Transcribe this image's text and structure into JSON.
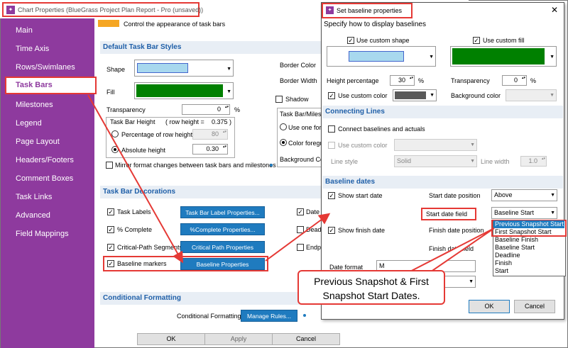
{
  "main_window": {
    "title": "Chart Properties (BlueGrass Project Plan Report - Pro (unsaved))",
    "header_text": "Control the appearance of task bars",
    "ok": "OK",
    "apply": "Apply",
    "cancel": "Cancel"
  },
  "sidebar": {
    "items": [
      {
        "label": "Main"
      },
      {
        "label": "Time Axis"
      },
      {
        "label": "Rows/Swimlanes"
      },
      {
        "label": "Task Bars"
      },
      {
        "label": "Milestones"
      },
      {
        "label": "Legend"
      },
      {
        "label": "Page Layout"
      },
      {
        "label": "Headers/Footers"
      },
      {
        "label": "Comment Boxes"
      },
      {
        "label": "Task Links"
      },
      {
        "label": "Advanced"
      },
      {
        "label": "Field Mappings"
      }
    ]
  },
  "styles": {
    "heading": "Default Task Bar Styles",
    "shape_label": "Shape",
    "fill_label": "Fill",
    "transparency_label": "Transparency",
    "transparency_value": "0",
    "pct": "%",
    "border_color": "Border Color",
    "border_width": "Border Width",
    "shadow": "Shadow",
    "height_group": "Task Bar Height",
    "row_height": "( row height =",
    "row_height_value": "0.375 )",
    "pct_row_height": "Percentage of row height",
    "pct_row_value": "80",
    "absolute_height": "Absolute height",
    "absolute_value": "0.30",
    "milestone_group": "Task Bar/Milestone",
    "use_one": "Use one fore",
    "color_fore": "Color foregro",
    "bg_color": "Background Colo",
    "mirror": "Mirror format changes between task bars and milestones"
  },
  "decorations": {
    "heading": "Task Bar Decorations",
    "task_labels": "Task Labels",
    "task_labels_btn": "Task Bar Label Properties...",
    "pct_complete": "% Complete",
    "pct_complete_btn": "%Complete Properties...",
    "critical": "Critical-Path Segments",
    "critical_btn": "Critical Path Properties",
    "baseline": "Baseline markers",
    "baseline_btn": "Baseline Properties",
    "date_l": "Date L",
    "deadl": "Deadli",
    "endpo": "Endpo"
  },
  "conditional": {
    "heading": "Conditional Formatting",
    "label": "Conditional Formatting",
    "btn": "Manage Rules..."
  },
  "dialog": {
    "title": "Set baseline properties",
    "subtitle": "Specify how to display baselines",
    "use_custom_shape": "Use custom shape",
    "use_custom_fill": "Use custom fill",
    "height_percentage": "Height percentage",
    "height_value": "30",
    "pct": "%",
    "transparency": "Transparency",
    "transparency_value": "0",
    "use_custom_color": "Use custom color",
    "background_color": "Background color",
    "connecting_heading": "Connecting Lines",
    "connect": "Connect baselines and actuals",
    "use_custom_color2": "Use custom color",
    "line_style": "Line style",
    "line_style_value": "Solid",
    "line_width": "Line width",
    "line_width_value": "1.0",
    "dates_heading": "Baseline dates",
    "show_start": "Show start date",
    "start_pos_label": "Start date position",
    "start_pos_value": "Above",
    "start_field_label": "Start date field",
    "start_field_value": "Baseline Start",
    "show_finish": "Show finish date",
    "finish_pos_label": "Finish date position",
    "finish_field_label": "Finish date field",
    "date_format": "Date format",
    "date_format_value": "M",
    "dropdown_options": [
      "Previous Snapshot Start",
      "First Snapshot Start",
      "Baseline Finish",
      "Baseline Start",
      "Deadline",
      "Finish",
      "Start"
    ],
    "ok": "OK",
    "cancel": "Cancel"
  },
  "callout": {
    "line1": "Previous Snapshot & First",
    "line2": "Snapshot Start Dates."
  },
  "colors": {
    "purple": "#8e3a9e",
    "highlight_red": "#e53935",
    "fill_green": "#008000",
    "shape_blue": "#a8d8ee",
    "section_blue": "#1f5fa8",
    "button_blue": "#1f7bbf"
  }
}
